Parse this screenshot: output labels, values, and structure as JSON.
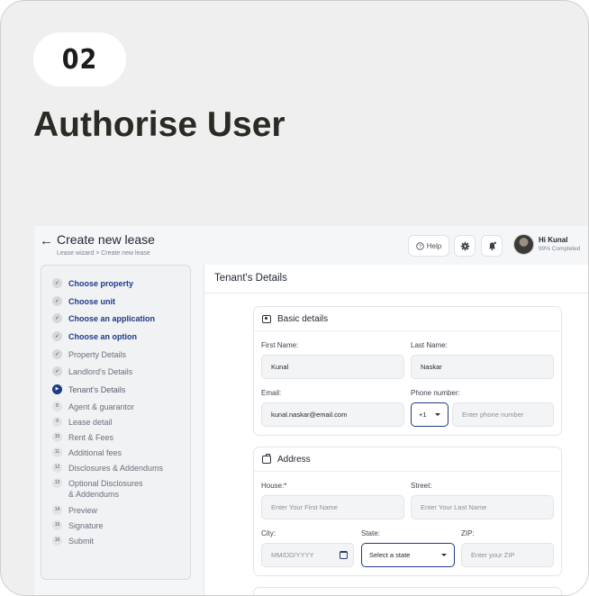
{
  "card": {
    "step_number": "02",
    "headline": "Authorise User"
  },
  "header": {
    "title": "Create new lease",
    "breadcrumb": "Lease wizard > Create new lease",
    "help_label": "Help",
    "user_greeting": "Hi Kunal",
    "user_progress": "99% Completed"
  },
  "sidebar": {
    "steps": [
      {
        "label": "Choose property",
        "state": "done-blue",
        "marker": "✓"
      },
      {
        "label": "Choose unit",
        "state": "done-blue",
        "marker": "✓"
      },
      {
        "label": "Choose an application",
        "state": "done-blue",
        "marker": "✓"
      },
      {
        "label": "Choose an option",
        "state": "done-blue",
        "marker": "✓"
      },
      {
        "label": "Property Details",
        "state": "done-gray",
        "marker": "✓"
      },
      {
        "label": "Landlord's Details",
        "state": "done-gray",
        "marker": "✓"
      },
      {
        "label": "Tenant's Details",
        "state": "active",
        "marker": "▶"
      },
      {
        "label": "Agent & guarantor",
        "state": "todo",
        "marker": "8"
      },
      {
        "label": "Lease detail",
        "state": "todo",
        "marker": "9"
      },
      {
        "label": "Rent & Fees",
        "state": "todo",
        "marker": "10"
      },
      {
        "label": "Additional fees",
        "state": "todo",
        "marker": "11"
      },
      {
        "label": "Disclosures & Addendums",
        "state": "todo",
        "marker": "12"
      },
      {
        "label": "Optional Disclosures",
        "label2": "& Addendums",
        "state": "todo",
        "marker": "13"
      },
      {
        "label": "Preview",
        "state": "todo",
        "marker": "14"
      },
      {
        "label": "Signature",
        "state": "todo",
        "marker": "15"
      },
      {
        "label": "Submit",
        "state": "todo",
        "marker": "16"
      }
    ]
  },
  "main": {
    "title": "Tenant's Details",
    "basic": {
      "heading": "Basic details",
      "first_name_label": "First Name:",
      "first_name_value": "Kunal",
      "last_name_label": "Last Name:",
      "last_name_value": "Naskar",
      "email_label": "Email:",
      "email_value": "kunal.naskar@email.com",
      "phone_label": "Phone number:",
      "country_code": "+1",
      "phone_placeholder": "Enter phone number"
    },
    "address": {
      "heading": "Address",
      "house_label": "House:*",
      "house_placeholder": "Enter Your First Name",
      "street_label": "Street:",
      "street_placeholder": "Enter Your Last Name",
      "city_label": "City:",
      "city_placeholder": "MM/DD/YYYY",
      "state_label": "State:",
      "state_value": "Select a state",
      "zip_label": "ZIP:",
      "zip_placeholder": "Enter your ZIP"
    }
  },
  "colors": {
    "accent": "#1e3a8a",
    "card_bg": "#efefef"
  },
  "icons": [
    "back-arrow-icon",
    "help-icon",
    "gear-icon",
    "bell-icon",
    "check-icon",
    "play-icon",
    "id-card-icon",
    "address-icon",
    "calendar-icon",
    "chevron-down-icon"
  ]
}
